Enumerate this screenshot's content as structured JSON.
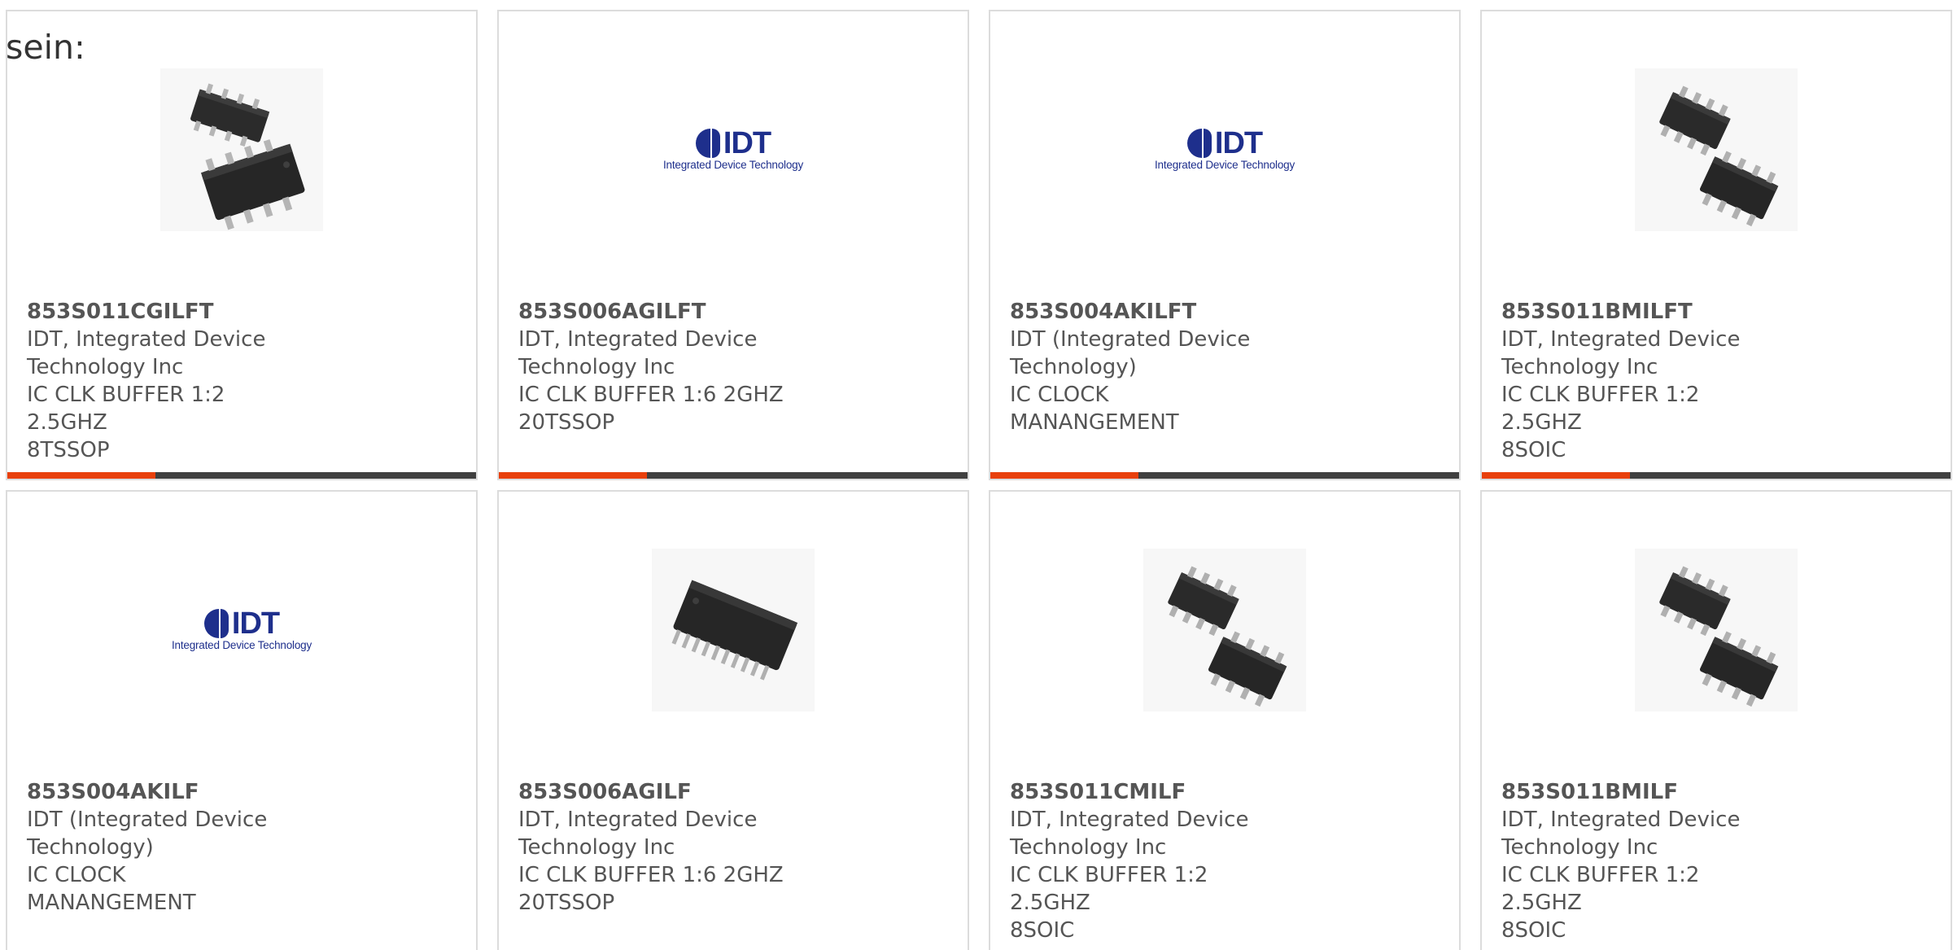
{
  "intro_text": "sein:",
  "colors": {
    "accent": "#e8400c",
    "bar": "#3f3f3f",
    "text": "#555555",
    "border": "#dcdcdc",
    "idt_blue": "#1e2f8c"
  },
  "logo": {
    "name": "IDT",
    "tagline": "Integrated Device Technology"
  },
  "products": [
    {
      "part": "853S011CGILFT",
      "maker_line1": "IDT, Integrated Device",
      "maker_line2": "Technology Inc",
      "desc_line1": "IC CLK BUFFER 1:2 2.5GHZ",
      "desc_line2": "8TSSOP",
      "image": "tssop-8-chip-icon"
    },
    {
      "part": "853S006AGILFT",
      "maker_line1": "IDT, Integrated Device",
      "maker_line2": "Technology Inc",
      "desc_line1": "IC CLK BUFFER 1:6 2GHZ",
      "desc_line2": "20TSSOP",
      "image": "idt-logo"
    },
    {
      "part": "853S004AKILFT",
      "maker_line1": "IDT (Integrated Device",
      "maker_line2": "Technology)",
      "desc_line1": "IC CLOCK MANANGEMENT",
      "desc_line2": "",
      "image": "idt-logo"
    },
    {
      "part": "853S011BMILFT",
      "maker_line1": "IDT, Integrated Device",
      "maker_line2": "Technology Inc",
      "desc_line1": "IC CLK BUFFER 1:2 2.5GHZ",
      "desc_line2": "8SOIC",
      "image": "soic-8-chip-icon"
    },
    {
      "part": "853S004AKILF",
      "maker_line1": "IDT (Integrated Device",
      "maker_line2": "Technology)",
      "desc_line1": "IC CLOCK MANANGEMENT",
      "desc_line2": "",
      "image": "idt-logo"
    },
    {
      "part": "853S006AGILF",
      "maker_line1": "IDT, Integrated Device",
      "maker_line2": "Technology Inc",
      "desc_line1": "IC CLK BUFFER 1:6 2GHZ",
      "desc_line2": "20TSSOP",
      "image": "tssop-20-chip-icon"
    },
    {
      "part": "853S011CMILF",
      "maker_line1": "IDT, Integrated Device",
      "maker_line2": "Technology Inc",
      "desc_line1": "IC CLK BUFFER 1:2 2.5GHZ",
      "desc_line2": "8SOIC",
      "image": "soic-8-chip-icon"
    },
    {
      "part": "853S011BMILF",
      "maker_line1": "IDT, Integrated Device",
      "maker_line2": "Technology Inc",
      "desc_line1": "IC CLK BUFFER 1:2 2.5GHZ",
      "desc_line2": "8SOIC",
      "image": "soic-8-chip-icon"
    }
  ]
}
